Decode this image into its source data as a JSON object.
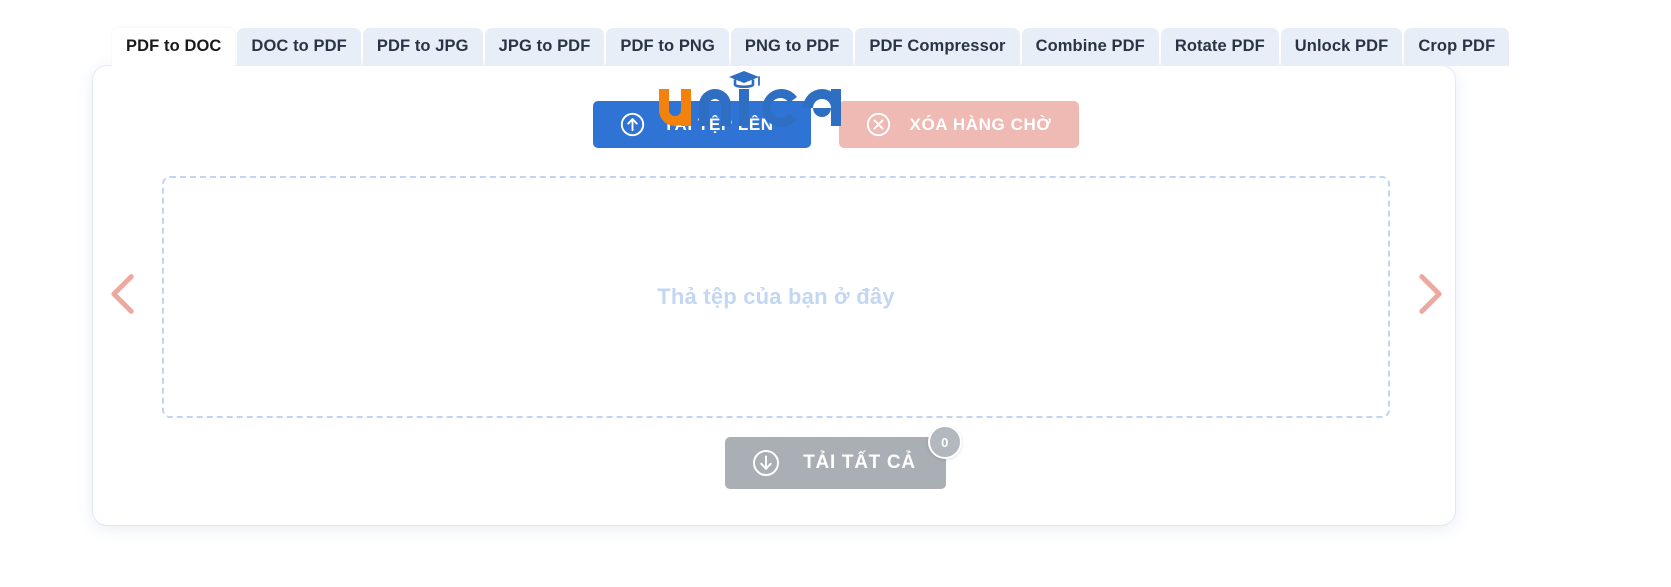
{
  "tabs": [
    {
      "label": "PDF to DOC",
      "active": true
    },
    {
      "label": "DOC to PDF",
      "active": false
    },
    {
      "label": "PDF to JPG",
      "active": false
    },
    {
      "label": "JPG to PDF",
      "active": false
    },
    {
      "label": "PDF to PNG",
      "active": false
    },
    {
      "label": "PNG to PDF",
      "active": false
    },
    {
      "label": "PDF Compressor",
      "active": false
    },
    {
      "label": "Combine PDF",
      "active": false
    },
    {
      "label": "Rotate PDF",
      "active": false
    },
    {
      "label": "Unlock PDF",
      "active": false
    },
    {
      "label": "Crop PDF",
      "active": false
    }
  ],
  "actions": {
    "upload_label": "TẢI TỆP LÊN",
    "upload_icon": "upload-circle-arrow-up-icon",
    "upload_color": "#2f73d4",
    "clear_label": "XÓA HÀNG CHỜ",
    "clear_icon": "close-circle-x-icon",
    "clear_color": "#efb9b4"
  },
  "dropzone": {
    "placeholder": "Thả tệp của bạn ở đây",
    "border_color": "#c2d4ef",
    "text_color": "#c3d6f2"
  },
  "carousel": {
    "prev_icon": "chevron-left-icon",
    "next_icon": "chevron-right-icon",
    "arrow_color": "#eda9a0"
  },
  "download": {
    "label": "TẢI TẤT CẢ",
    "icon": "download-circle-arrow-down-icon",
    "count": "0",
    "color": "#aaafb5"
  },
  "watermark": {
    "text": "unica",
    "letter_u": "u",
    "letter_n": "n",
    "letter_i": "i",
    "letter_c": "c",
    "letter_a": "a",
    "orange": "#F2820C",
    "blue": "#2E6FC4",
    "cap_icon": "graduation-cap-icon"
  }
}
